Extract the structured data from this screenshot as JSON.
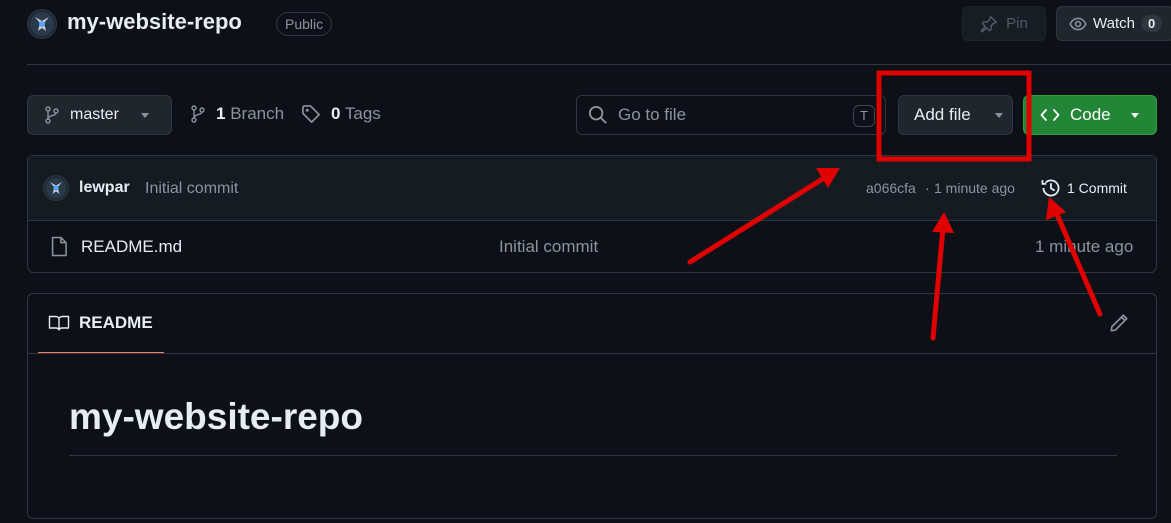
{
  "repo": {
    "name": "my-website-repo",
    "visibility": "Public",
    "pin_label": "Pin",
    "watch_label": "Watch",
    "watch_count": "0"
  },
  "toolbar": {
    "branch_name": "master",
    "branch_count": "1",
    "branch_label": "Branch",
    "tag_count": "0",
    "tag_label": "Tags",
    "search_placeholder": "Go to file",
    "search_shortcut": "T",
    "add_file_label": "Add file",
    "code_label": "Code"
  },
  "latest_commit": {
    "author": "lewpar",
    "message": "Initial commit",
    "hash": "a066cfa",
    "separator": "·",
    "time": "1 minute ago",
    "commits_label": "1 Commit"
  },
  "files": [
    {
      "name": "README.md",
      "message": "Initial commit",
      "time": "1 minute ago"
    }
  ],
  "readme": {
    "tab_label": "README",
    "heading": "my-website-repo"
  },
  "colors": {
    "background": "#0d1117",
    "border": "#30363d",
    "code_button": "#238636",
    "annotation": "#e00000",
    "tab_underline": "#f78166"
  },
  "icons": [
    "repo-avatar-icon",
    "pin-icon",
    "eye-icon",
    "branch-icon",
    "tag-icon",
    "search-icon",
    "caret-down-icon",
    "code-icon",
    "history-icon",
    "file-icon",
    "book-icon",
    "pencil-icon"
  ]
}
